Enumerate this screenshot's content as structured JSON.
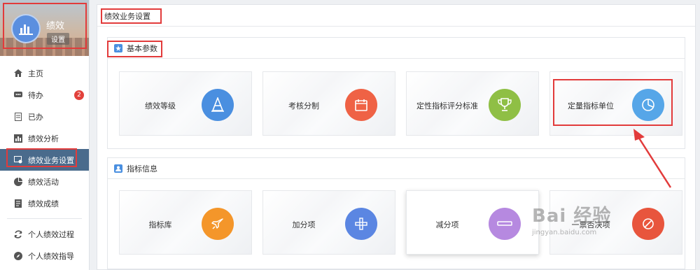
{
  "sidebar": {
    "user_name": "绩效",
    "settings_label": "设置",
    "items": [
      {
        "label": "主页",
        "icon": "home-icon"
      },
      {
        "label": "待办",
        "icon": "chat-icon",
        "badge": "2"
      },
      {
        "label": "已办",
        "icon": "document-icon"
      },
      {
        "label": "绩效分析",
        "icon": "bar-chart-icon"
      },
      {
        "label": "绩效业务设置",
        "icon": "settings-screen-icon"
      },
      {
        "label": "绩效活动",
        "icon": "pie-chart-icon"
      },
      {
        "label": "绩效成绩",
        "icon": "report-icon"
      },
      {
        "label": "个人绩效过程",
        "icon": "refresh-icon"
      },
      {
        "label": "个人绩效指导",
        "icon": "compass-icon"
      }
    ]
  },
  "main": {
    "title": "绩效业务设置",
    "sections": [
      {
        "title": "基本参数",
        "cards": [
          {
            "label": "绩效等级",
            "icon": "cone-icon",
            "color": "#4a8fe0"
          },
          {
            "label": "考核分制",
            "icon": "calendar-icon",
            "color": "#ef6245"
          },
          {
            "label": "定性指标评分标准",
            "icon": "trophy-icon",
            "color": "#8fbf45"
          },
          {
            "label": "定量指标单位",
            "icon": "pie-chart-icon",
            "color": "#56a6e8"
          }
        ]
      },
      {
        "title": "指标信息",
        "cards": [
          {
            "label": "指标库",
            "icon": "rocket-icon",
            "color": "#f4962a"
          },
          {
            "label": "加分项",
            "icon": "plus-icon",
            "color": "#5b86e2"
          },
          {
            "label": "减分项",
            "icon": "minus-icon",
            "color": "#b689e0"
          },
          {
            "label": "一票否决项",
            "icon": "veto-icon",
            "color": "#e8553d"
          }
        ]
      }
    ]
  },
  "watermark": {
    "brand": "Bai 经验",
    "url": "jingyan.baidu.com"
  },
  "colors": {
    "accent": "#4a6b8c",
    "annotation": "#e23b3b",
    "badge": "#e2413b"
  }
}
